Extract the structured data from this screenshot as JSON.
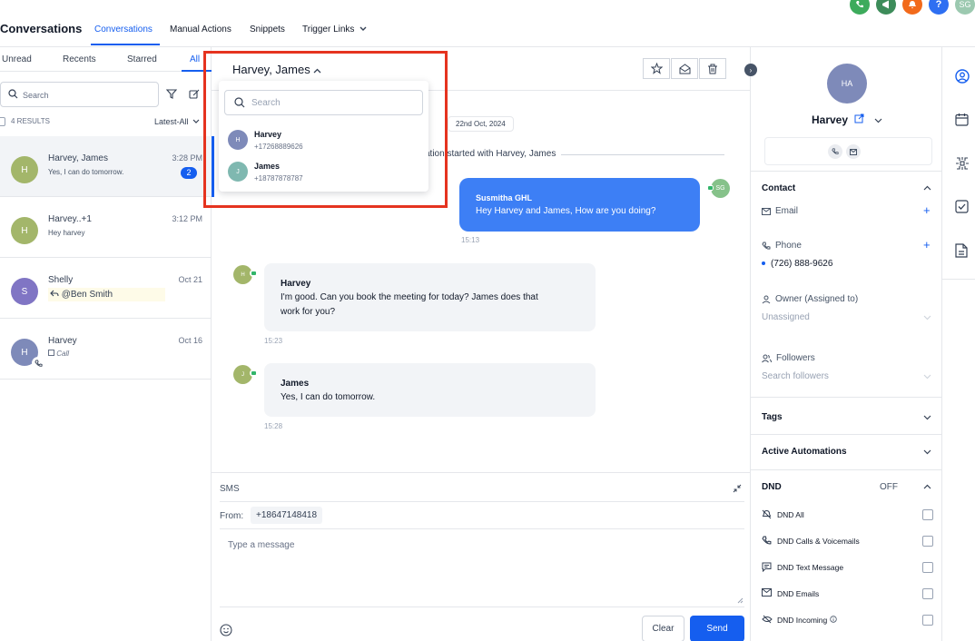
{
  "app": {
    "title": "Conversations"
  },
  "nav": {
    "items": [
      {
        "label": "Conversations"
      },
      {
        "label": "Manual Actions"
      },
      {
        "label": "Snippets"
      },
      {
        "label": "Trigger Links"
      }
    ],
    "user_initials": "SG"
  },
  "left": {
    "tabs": [
      {
        "label": "Unread"
      },
      {
        "label": "Recents"
      },
      {
        "label": "Starred"
      },
      {
        "label": "All"
      }
    ],
    "search_placeholder": "Search",
    "results_label": "4 RESULTS",
    "sort_label": "Latest-All",
    "conversations": [
      {
        "initials": "H",
        "name": "Harvey, James",
        "preview": "Yes, I can do tomorrow.",
        "time": "3:28 PM",
        "badge": "2",
        "color": "#a3b66a"
      },
      {
        "initials": "H",
        "name": "Harvey..+1",
        "preview": "Hey harvey",
        "time": "3:12 PM",
        "color": "#a3b66a"
      },
      {
        "initials": "S",
        "name": "Shelly",
        "preview": "@Ben Smith",
        "time": "Oct 21",
        "color": "#8075c4"
      },
      {
        "initials": "H",
        "name": "Harvey",
        "preview": "Call",
        "time": "Oct 16",
        "color": "#7e8ab9"
      }
    ]
  },
  "chat": {
    "header_name": "Harvey, James",
    "date_chip": "22nd Oct, 2024",
    "started_text": "ation started with Harvey, James",
    "outgoing": {
      "sender": "Susmitha GHL",
      "text": "Hey Harvey and James, How are you doing?",
      "time": "15:13",
      "avatar": "SG"
    },
    "incoming": [
      {
        "avatar": "H",
        "sender": "Harvey",
        "text_line1": "I'm good. Can you book the meeting for today? James does that",
        "text_line2": "work for you?",
        "time": "15:23"
      },
      {
        "avatar": "J",
        "sender": "James",
        "text_line1": "Yes, I can do tomorrow.",
        "text_line2": "",
        "time": "15:28"
      }
    ]
  },
  "dropdown": {
    "search_placeholder": "Search",
    "items": [
      {
        "initials": "H",
        "name": "Harvey",
        "phone": "+17268889626",
        "color": "#7e8ab9"
      },
      {
        "initials": "J",
        "name": "James",
        "phone": "+18787878787",
        "color": "#7fb8b0"
      }
    ]
  },
  "composer": {
    "channel": "SMS",
    "from_label": "From:",
    "from_number": "+18647148418",
    "message_placeholder": "Type a message",
    "clear_label": "Clear",
    "send_label": "Send"
  },
  "contact": {
    "initials": "HA",
    "name": "Harvey",
    "contact_heading": "Contact",
    "email_label": "Email",
    "phone_label": "Phone",
    "phone_value": "(726) 888-9626",
    "owner_label": "Owner (Assigned to)",
    "owner_value": "Unassigned",
    "followers_label": "Followers",
    "followers_placeholder": "Search followers",
    "tags_heading": "Tags",
    "automations_heading": "Active Automations",
    "dnd_heading": "DND",
    "dnd_status": "OFF",
    "dnd_options": [
      {
        "label": "DND All"
      },
      {
        "label": "DND Calls & Voicemails"
      },
      {
        "label": "DND Text Message"
      },
      {
        "label": "DND Emails"
      },
      {
        "label": "DND Incoming"
      }
    ]
  },
  "colors": {
    "accent": "#155eef",
    "bubble_out": "#3d7ff5",
    "highlight": "#e5331f"
  }
}
